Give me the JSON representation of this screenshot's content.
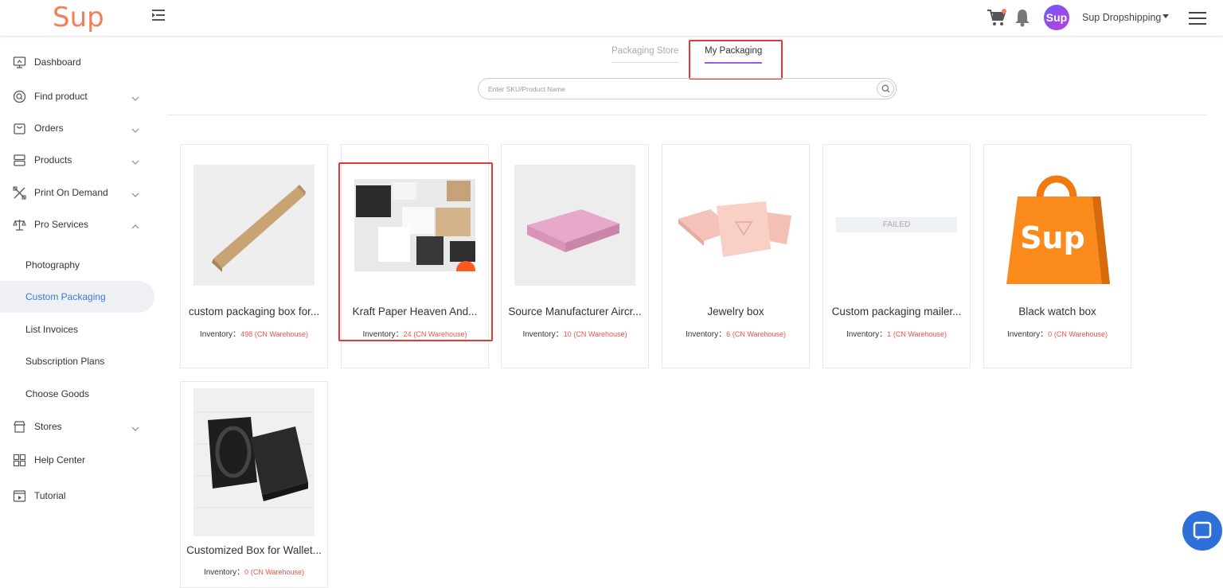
{
  "header": {
    "logo": "Sup",
    "avatar_text": "Sup",
    "username": "Sup Dropshipping"
  },
  "sidebar": {
    "items": [
      {
        "label": "Dashboard"
      },
      {
        "label": "Find product"
      },
      {
        "label": "Orders"
      },
      {
        "label": "Products"
      },
      {
        "label": "Print On Demand"
      },
      {
        "label": "Pro Services"
      }
    ],
    "sub_items": [
      {
        "label": "Photography"
      },
      {
        "label": "Custom Packaging"
      },
      {
        "label": "List Invoices"
      },
      {
        "label": "Subscription Plans"
      },
      {
        "label": "Choose Goods"
      }
    ],
    "bottom_items": [
      {
        "label": "Stores"
      },
      {
        "label": "Help Center"
      },
      {
        "label": "Tutorial"
      }
    ]
  },
  "tabs": {
    "store": "Packaging Store",
    "mine": "My Packaging"
  },
  "search": {
    "placeholder": "Enter SKU/Product Name"
  },
  "inventory_label": "Inventory：",
  "warehouse_label": "(CN Warehouse)",
  "failed_text": "FAILED",
  "products": [
    {
      "title": "custom packaging box for...",
      "inventory": "498"
    },
    {
      "title": "Kraft Paper Heaven And...",
      "inventory": "24"
    },
    {
      "title": "Source Manufacturer Aircr...",
      "inventory": "10"
    },
    {
      "title": "Jewelry box",
      "inventory": "6"
    },
    {
      "title": "Custom packaging mailer...",
      "inventory": "1"
    },
    {
      "title": "Black watch box",
      "inventory": "0"
    },
    {
      "title": "Customized Box for Wallet...",
      "inventory": "0"
    }
  ],
  "colors": {
    "accent": "#3a7bd5",
    "tab_underline": "#9b5de5",
    "highlight": "#e53935",
    "inventory_number": "#e8534a",
    "logo": "#f0805a"
  }
}
